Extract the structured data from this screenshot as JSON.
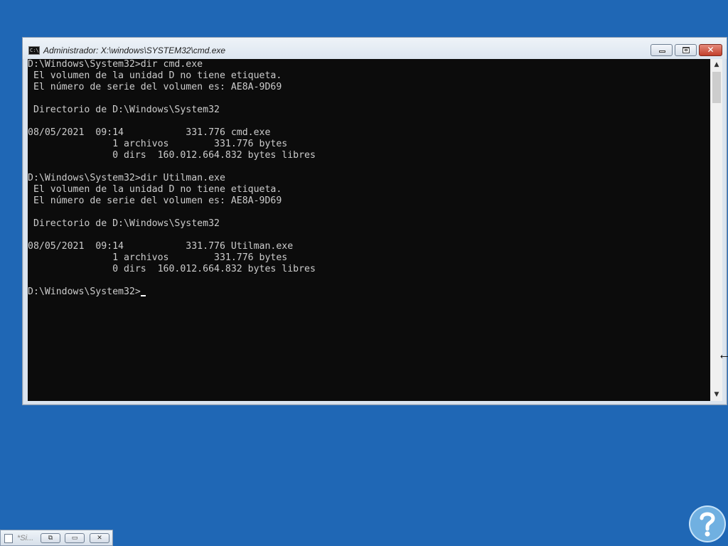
{
  "window": {
    "title": "Administrador: X:\\windows\\SYSTEM32\\cmd.exe",
    "icon_label": "C:\\",
    "buttons": {
      "minimize": "minimize-icon",
      "maximize": "maximize-icon",
      "close": "close-icon"
    }
  },
  "console": {
    "lines": [
      "D:\\Windows\\System32>dir cmd.exe",
      " El volumen de la unidad D no tiene etiqueta.",
      " El número de serie del volumen es: AE8A-9D69",
      "",
      " Directorio de D:\\Windows\\System32",
      "",
      "08/05/2021  09:14           331.776 cmd.exe",
      "               1 archivos        331.776 bytes",
      "               0 dirs  160.012.664.832 bytes libres",
      "",
      "D:\\Windows\\System32>dir Utilman.exe",
      " El volumen de la unidad D no tiene etiqueta.",
      " El número de serie del volumen es: AE8A-9D69",
      "",
      " Directorio de D:\\Windows\\System32",
      "",
      "08/05/2021  09:14           331.776 Utilman.exe",
      "               1 archivos        331.776 bytes",
      "               0 dirs  160.012.664.832 bytes libres",
      ""
    ],
    "prompt": "D:\\Windows\\System32>"
  },
  "scrollbar": {
    "up_icon": "scroll-up-arrow-icon",
    "down_icon": "scroll-down-arrow-icon",
    "up_glyph": "▲",
    "down_glyph": "▼"
  },
  "minimized_window": {
    "title": "*Si...",
    "restore_glyph": "⧉",
    "maximize_glyph": "▭",
    "close_glyph": "✕"
  },
  "colors": {
    "desktop": "#1f67b5",
    "console_bg": "#0c0c0c",
    "console_text": "#cccccc"
  }
}
